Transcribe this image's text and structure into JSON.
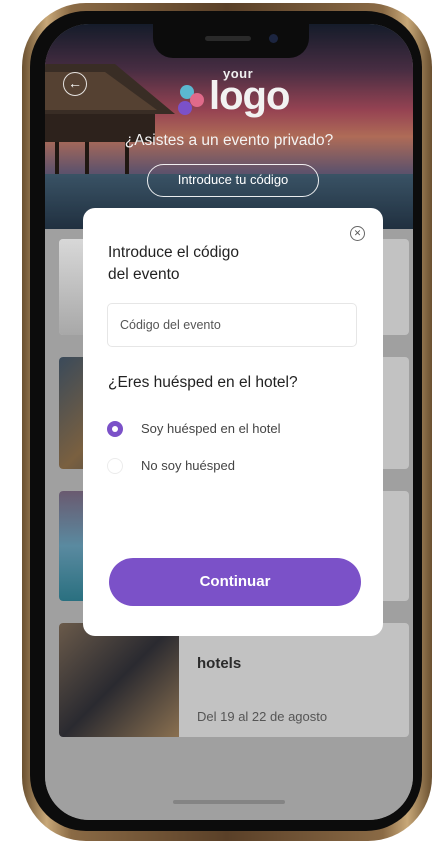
{
  "header": {
    "logo_small": "your",
    "logo_main": "logo",
    "question": "¿Asistes a un evento privado?",
    "code_button_label": "Introduce tu código"
  },
  "cards": [
    {
      "title": "",
      "date": ""
    },
    {
      "title": "",
      "date": ""
    },
    {
      "title": "",
      "date": ""
    },
    {
      "title": "hotels",
      "date": "Del 19 al 22 de agosto"
    }
  ],
  "modal": {
    "title_line1": "Introduce el código",
    "title_line2": "del evento",
    "code_placeholder": "Código del evento",
    "code_value": "",
    "guest_question": "¿Eres huésped en el hotel?",
    "options": [
      {
        "label": "Soy huésped en el hotel",
        "selected": true
      },
      {
        "label": "No soy huésped",
        "selected": false
      }
    ],
    "continue_label": "Continuar"
  },
  "colors": {
    "accent": "#7b51c8",
    "overlay": "#9a9a9a"
  },
  "icons": [
    "back-arrow-icon",
    "close-icon",
    "logo-mark-icon"
  ]
}
